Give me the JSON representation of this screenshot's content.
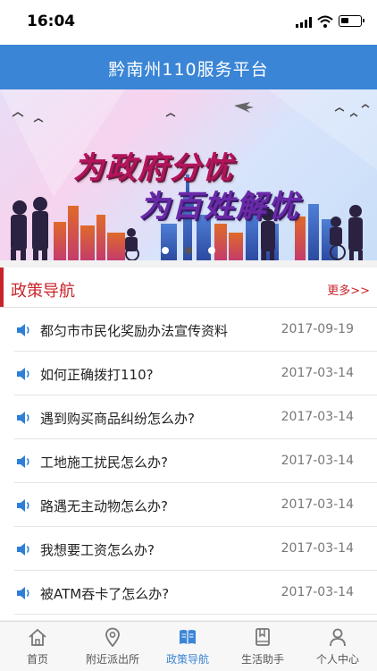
{
  "status_bar": {
    "time": "16:04"
  },
  "header": {
    "title": "黔南州110服务平台"
  },
  "banner": {
    "slogan_line1": "为政府分忧",
    "slogan_line2": "为百姓解忧",
    "slide_count": 3,
    "active_slide": 2
  },
  "section": {
    "title": "政策导航",
    "more_label": "更多>>",
    "items": [
      {
        "title": "都匀市市民化奖励办法宣传资料",
        "date": "2017-09-19"
      },
      {
        "title": "如何正确拨打110?",
        "date": "2017-03-14"
      },
      {
        "title": "遇到购买商品纠纷怎么办?",
        "date": "2017-03-14"
      },
      {
        "title": "工地施工扰民怎么办?",
        "date": "2017-03-14"
      },
      {
        "title": "路遇无主动物怎么办?",
        "date": "2017-03-14"
      },
      {
        "title": "我想要工资怎么办?",
        "date": "2017-03-14"
      },
      {
        "title": "被ATM吞卡了怎么办?",
        "date": "2017-03-14"
      }
    ]
  },
  "tabbar": {
    "tabs": [
      {
        "label": "首页",
        "icon": "home-icon"
      },
      {
        "label": "附近派出所",
        "icon": "location-pin-icon"
      },
      {
        "label": "政策导航",
        "icon": "book-icon"
      },
      {
        "label": "生活助手",
        "icon": "bookmark-book-icon"
      },
      {
        "label": "个人中心",
        "icon": "person-icon"
      }
    ],
    "active_index": 2
  },
  "colors": {
    "header_bg": "#3a85d6",
    "accent_red": "#c8242b",
    "active_tab": "#3a85d6"
  }
}
